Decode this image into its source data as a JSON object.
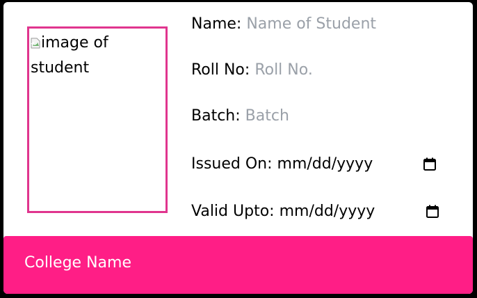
{
  "card": {
    "photo_alt": "image of student",
    "fields": {
      "name": {
        "label": "Name:",
        "placeholder": "Name of Student"
      },
      "roll": {
        "label": "Roll No:",
        "placeholder": "Roll No."
      },
      "batch": {
        "label": "Batch:",
        "placeholder": "Batch"
      },
      "issued": {
        "label": "Issued On:",
        "value": "mm/dd/yyyy",
        "icon": "calendar-icon"
      },
      "valid": {
        "label": "Valid Upto:",
        "value": "mm/dd/yyyy",
        "icon": "calendar-icon"
      }
    },
    "footer": {
      "college_name": "College Name"
    }
  },
  "colors": {
    "accent": "#ff1e86",
    "frame": "#e0358e",
    "placeholder": "#9aa0a8",
    "background": "#000000"
  }
}
